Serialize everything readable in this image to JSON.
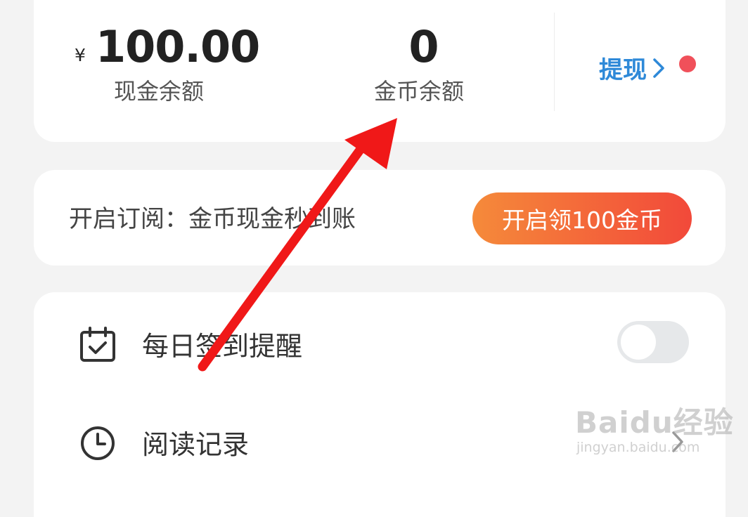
{
  "balance": {
    "currency_symbol": "¥",
    "cash_amount": "100.00",
    "cash_label": "现金余额",
    "coin_amount": "0",
    "coin_label": "金币余额",
    "withdraw_label": "提现",
    "withdraw_dot_color": "#f0505a"
  },
  "subscribe": {
    "text": "开启订阅：金币现金秒到账",
    "button_label": "开启领100金币"
  },
  "settings": {
    "items": [
      {
        "label": "每日签到提醒",
        "icon": "calendar-check-icon",
        "control": "toggle",
        "toggle_on": false
      },
      {
        "label": "阅读记录",
        "icon": "clock-icon",
        "control": "chevron"
      }
    ]
  },
  "annotation": {
    "arrow_color": "#f01818",
    "points_to": "coin_label"
  },
  "watermark": {
    "logo_text": "Baidu经验",
    "url": "jingyan.baidu.com"
  },
  "colors": {
    "accent_blue": "#2e89d8",
    "button_gradient_start": "#f58a3a",
    "button_gradient_end": "#f2493a",
    "background": "#f3f3f3"
  }
}
